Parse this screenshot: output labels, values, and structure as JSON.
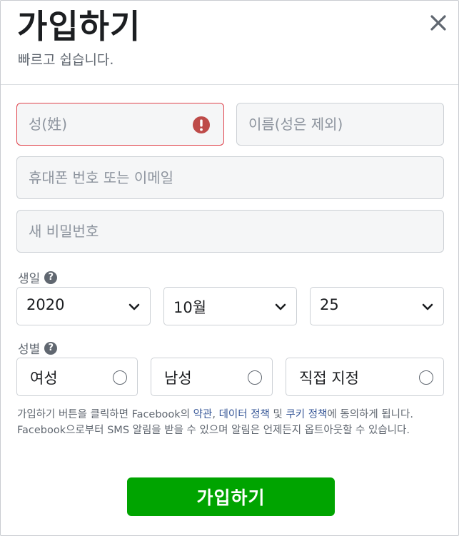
{
  "header": {
    "title": "가입하기",
    "subtitle": "빠르고 쉽습니다."
  },
  "form": {
    "last_name_placeholder": "성(姓)",
    "first_name_placeholder": "이름(성은 제외)",
    "contact_placeholder": "휴대폰 번호 또는 이메일",
    "password_placeholder": "새 비밀번호"
  },
  "birthday": {
    "label": "생일",
    "year": "2020",
    "month": "10월",
    "day": "25"
  },
  "gender": {
    "label": "성별",
    "options": [
      "여성",
      "남성",
      "직접 지정"
    ]
  },
  "terms": {
    "part1": "가입하기 버튼을 클릭하면 Facebook의 ",
    "link_terms": "약관",
    "sep1": ", ",
    "link_data": "데이터 정책",
    "sep2": " 및 ",
    "link_cookie": "쿠키 정책",
    "part2": "에 동의하게 됩니다. Facebook으로부터 SMS 알림을 받을 수 있으며 알림은 언제든지 옵트아웃할 수 있습니다."
  },
  "submit_label": "가입하기",
  "colors": {
    "accent_green": "#00a400",
    "error_red": "#e0424b",
    "link_blue": "#385898"
  }
}
